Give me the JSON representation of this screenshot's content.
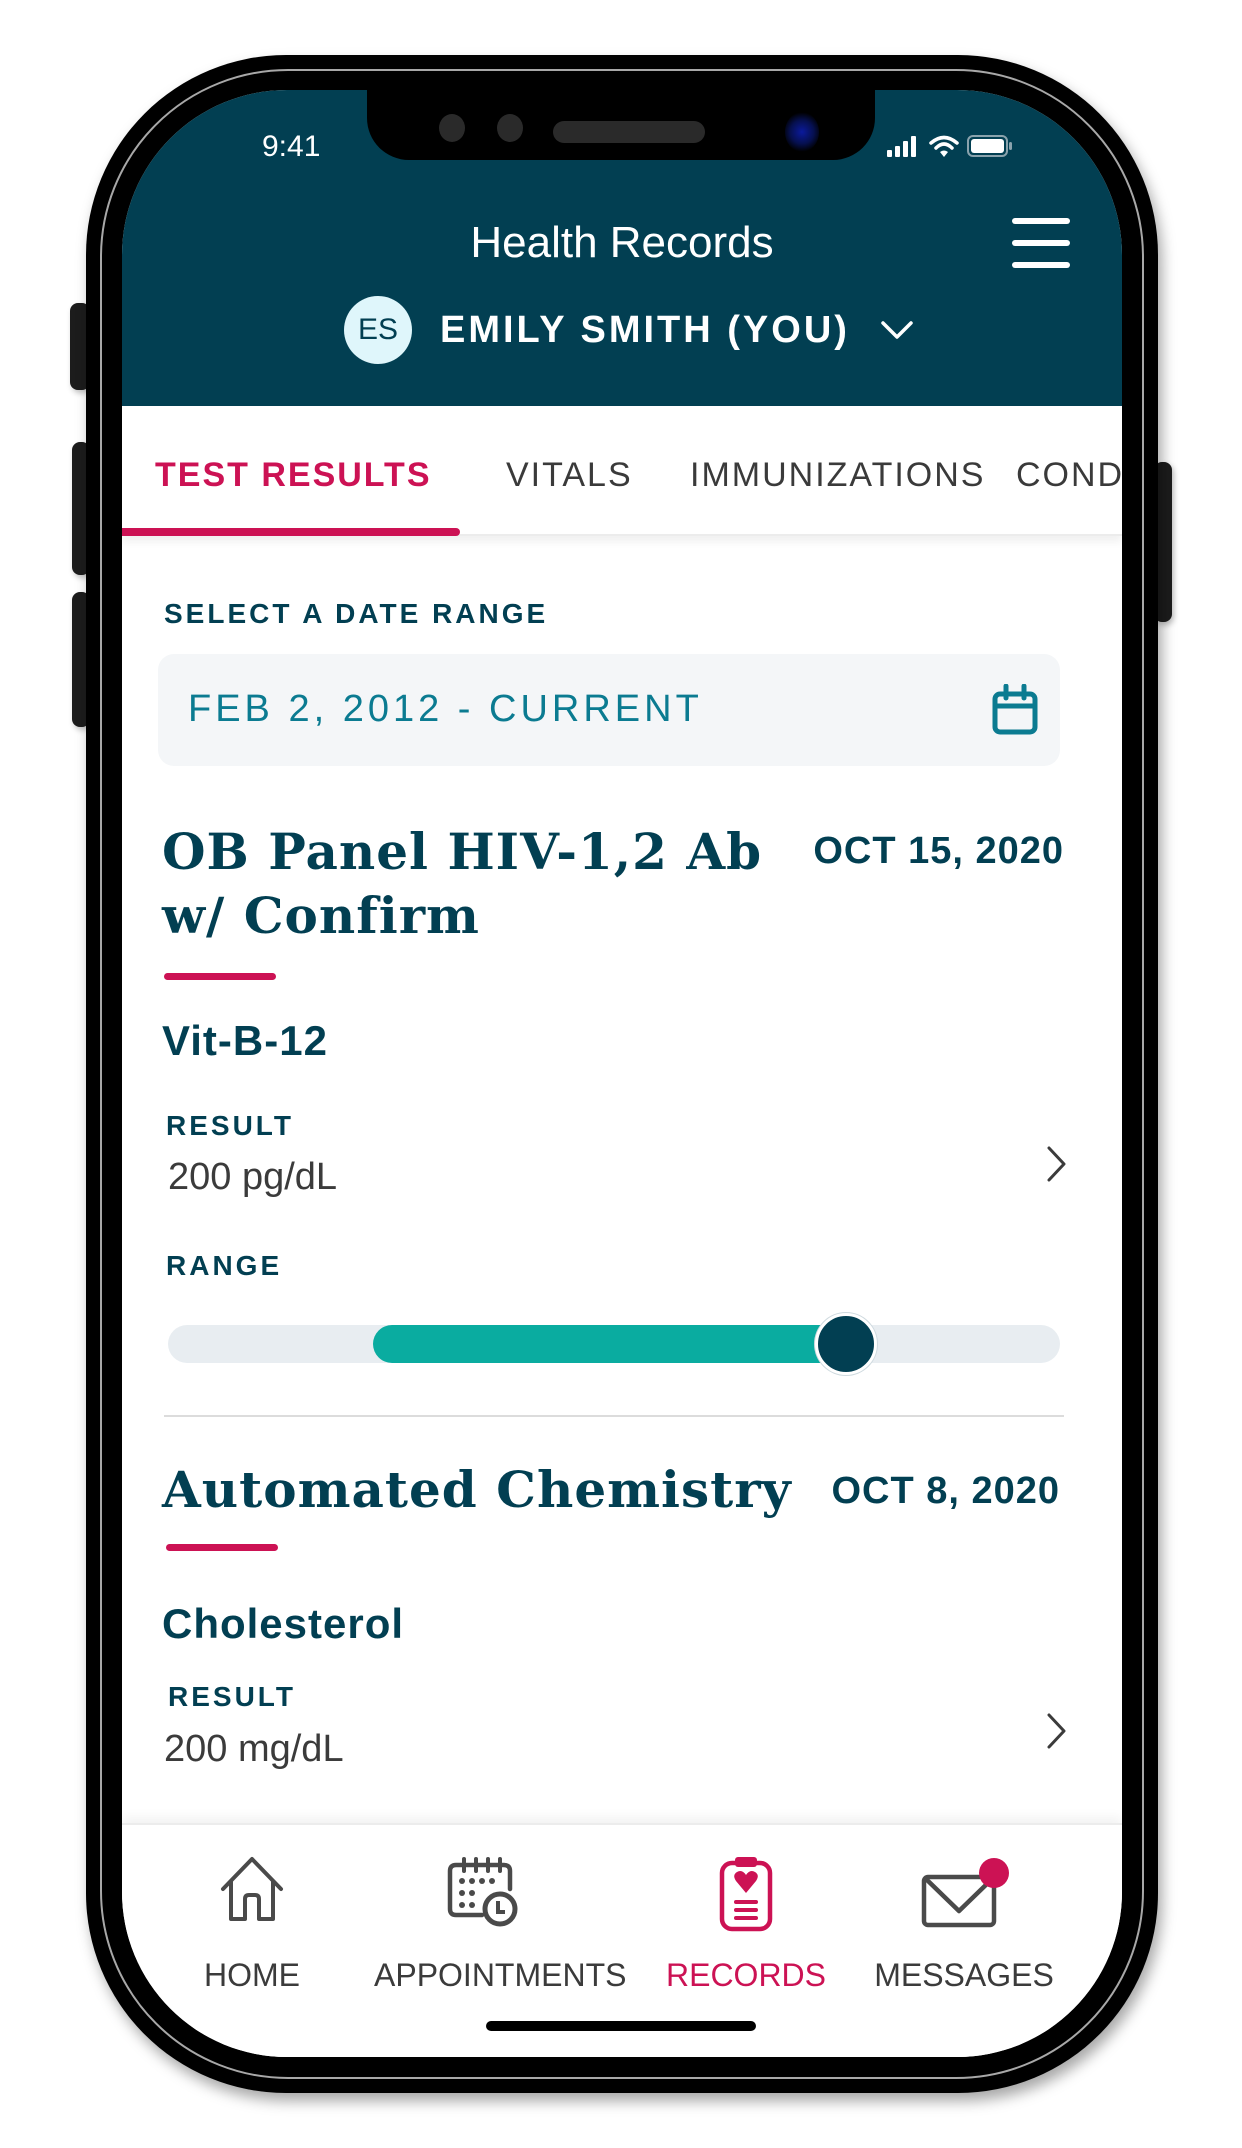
{
  "status_bar": {
    "time": "9:41",
    "icons": [
      "signal-icon",
      "wifi-icon",
      "battery-icon"
    ]
  },
  "header": {
    "title": "Health Records",
    "menu_icon": "hamburger-menu-icon",
    "profile": {
      "initials": "ES",
      "name": "EMILY SMITH (YOU)",
      "dropdown_icon": "chevron-down-icon"
    }
  },
  "tabs": [
    {
      "label": "TEST RESULTS",
      "active": true
    },
    {
      "label": "VITALS",
      "active": false
    },
    {
      "label": "IMMUNIZATIONS",
      "active": false
    },
    {
      "label": "COND",
      "active": false
    }
  ],
  "date_range": {
    "label": "SELECT A DATE RANGE",
    "value": "FEB 2, 2012 - CURRENT",
    "icon": "calendar-icon"
  },
  "sections": [
    {
      "title_line1": "OB Panel HIV-1,2 Ab",
      "title_line2": "w/ Confirm",
      "date": "OCT 15, 2020",
      "test": {
        "name": "Vit-B-12",
        "result_label": "RESULT",
        "result_value": "200 pg/dL",
        "range_label": "RANGE",
        "range": {
          "normal_start": 0.23,
          "value_position": 0.76
        }
      }
    },
    {
      "title_line1": "Automated Chemistry",
      "date": "OCT 8, 2020",
      "test": {
        "name": "Cholesterol",
        "result_label": "RESULT",
        "result_value": "200 mg/dL"
      }
    }
  ],
  "bottom_nav": [
    {
      "label": "HOME",
      "icon": "home-icon",
      "active": false
    },
    {
      "label": "APPOINTMENTS",
      "icon": "calendar-clock-icon",
      "active": false
    },
    {
      "label": "RECORDS",
      "icon": "clipboard-heart-icon",
      "active": true
    },
    {
      "label": "MESSAGES",
      "icon": "envelope-icon",
      "active": false,
      "badge": true
    }
  ],
  "colors": {
    "header_bg": "#023f52",
    "accent": "#cc1254",
    "teal": "#0aaca0",
    "date_text": "#0b7b91"
  }
}
